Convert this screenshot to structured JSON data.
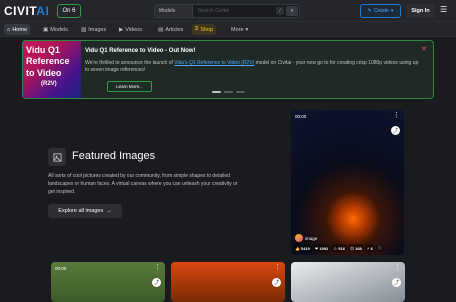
{
  "header": {
    "logo_main": "CIVIT",
    "logo_ai": "AI",
    "green_label": "On 6",
    "search_scope": "Models",
    "search_placeholder": "Search Civitai",
    "search_shortcut": "/",
    "create_label": "Create",
    "signin_label": "Sign In"
  },
  "nav": {
    "items": [
      {
        "label": "Home",
        "icon": "home-icon"
      },
      {
        "label": "Models",
        "icon": "models-icon"
      },
      {
        "label": "Images",
        "icon": "images-icon"
      },
      {
        "label": "Videos",
        "icon": "videos-icon"
      },
      {
        "label": "Articles",
        "icon": "articles-icon"
      },
      {
        "label": "Shop",
        "icon": "shop-icon"
      },
      {
        "label": "More",
        "icon": "chevron-down-icon"
      }
    ]
  },
  "banner": {
    "image_lines": [
      "Vidu Q1",
      "Reference",
      "to Video",
      "(R2V)"
    ],
    "title": "Vidu Q1 Reference to Video - Out Now!",
    "text_before": "We're thrilled to announce the launch of ",
    "link_text": "Vidu's Q1 Reference to Video (R2V)",
    "text_after": " model on Civitai - your new go to for creating crisp 1080p videos using up to seven image references!",
    "learn_more": "Learn More..."
  },
  "featured": {
    "title": "Featured Images",
    "description": "All sorts of cool pictures created by our community, from simple shapes to detailed landscapes or human faces. A virtual canvas where you can unleash your creativity or get inspired.",
    "button": "Explore all images"
  },
  "cards": [
    {
      "time": "00:00",
      "user": "image",
      "stats": [
        "5419",
        "1992",
        "516",
        "168",
        "6"
      ]
    },
    {
      "time": "00:00"
    },
    {
      "time": ""
    },
    {
      "time": ""
    }
  ],
  "colors": {
    "accent": "#1c7ed6",
    "green": "#2f9e44",
    "shop": "#fcc419",
    "close": "#fa5252"
  }
}
